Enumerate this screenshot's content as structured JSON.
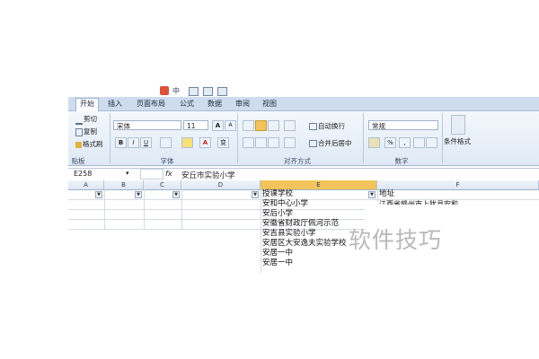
{
  "quick_access": {
    "label": "中"
  },
  "ribbon_tabs": [
    {
      "label": "开始",
      "active": true
    },
    {
      "label": "插入"
    },
    {
      "label": "页面布局"
    },
    {
      "label": "公式"
    },
    {
      "label": "数据"
    },
    {
      "label": "审阅"
    },
    {
      "label": "视图"
    }
  ],
  "clipboard": {
    "cut": "剪切",
    "copy": "复制",
    "format_painter": "格式刷",
    "group": "贴板"
  },
  "font": {
    "name": "宋体",
    "size": "11",
    "bold": "B",
    "italic": "I",
    "underline": "U",
    "grow": "A",
    "shrink": "A",
    "wen": "变",
    "group": "字体"
  },
  "alignment": {
    "wrap_text": "自动换行",
    "merge_center": "合并后居中",
    "group": "对齐方式"
  },
  "number": {
    "format": "常规",
    "percent": "%",
    "comma": ",",
    "group": "数字"
  },
  "styles": {
    "conditional": "条件格式"
  },
  "formula_bar": {
    "name_box": "E258",
    "fx": "fx",
    "content": "安丘市实验小学"
  },
  "columns": [
    "A",
    "B",
    "C",
    "D",
    "E",
    "F"
  ],
  "header_row": {
    "e": "授课学校",
    "f": "地址"
  },
  "column_e_cells": [
    "安和中心小学",
    "安后小学",
    "安徽省财政厅佩河示范",
    "安吉县实验小学",
    "安居区大安逸夫实验学校",
    "安居一中",
    "安居一中"
  ],
  "column_f_cell": "江西省赣州市上犹县安和",
  "watermark": "软件技巧",
  "colors": {
    "accent_selected": "#f3c45b",
    "ribbon_bg": "#dfe9f5"
  }
}
